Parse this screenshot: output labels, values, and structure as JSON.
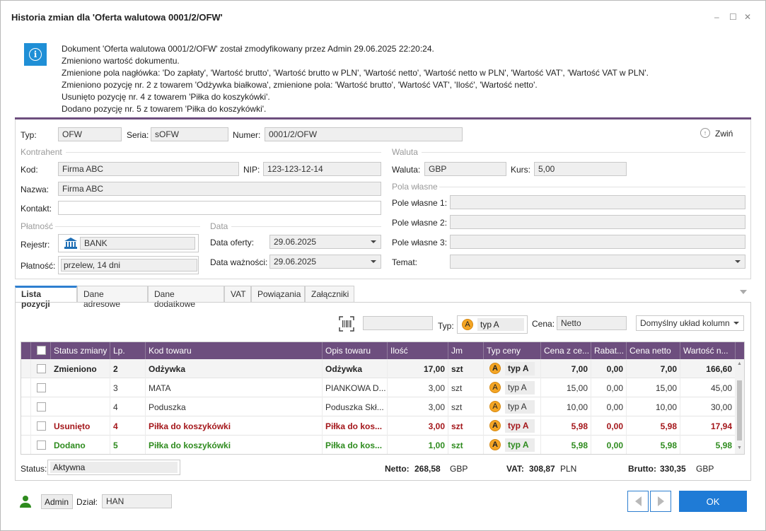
{
  "window": {
    "title": "Historia zmian dla 'Oferta walutowa 0001/2/OFW'",
    "min": "–",
    "max": "☐",
    "close": "✕"
  },
  "message": [
    "Dokument 'Oferta walutowa 0001/2/OFW' został zmodyfikowany przez Admin 29.06.2025 22:20:24.",
    "Zmieniono wartość dokumentu.",
    "Zmienione pola nagłówka: 'Do zapłaty', 'Wartość brutto', 'Wartość brutto w PLN', 'Wartość netto', 'Wartość netto w PLN', 'Wartość VAT', 'Wartość VAT w PLN'.",
    "Zmieniono pozycję nr. 2 z towarem 'Odżywka białkowa', zmienione pola: 'Wartość brutto', 'Wartość VAT', 'Ilość', 'Wartość netto'.",
    "Usunięto pozycję nr. 4 z towarem 'Piłka do koszykówki'.",
    "Dodano pozycję nr. 5 z towarem 'Piłka do koszykówki'."
  ],
  "header": {
    "typ_label": "Typ:",
    "typ": "OFW",
    "seria_label": "Seria:",
    "seria": "sOFW",
    "numer_label": "Numer:",
    "numer": "0001/2/OFW",
    "collapse": "Zwiń"
  },
  "kontrahent": {
    "section": "Kontrahent",
    "kod_label": "Kod:",
    "kod": "Firma ABC",
    "nip_label": "NIP:",
    "nip": "123-123-12-14",
    "nazwa_label": "Nazwa:",
    "nazwa": "Firma ABC",
    "kontakt_label": "Kontakt:",
    "kontakt": ""
  },
  "platnosc": {
    "section": "Płatność",
    "rejestr_label": "Rejestr:",
    "rejestr": "BANK",
    "platnosc_label": "Płatność:",
    "platnosc": "przelew, 14 dni"
  },
  "data": {
    "section": "Data",
    "oferty_label": "Data oferty:",
    "oferty": "29.06.2025",
    "waznosci_label": "Data ważności:",
    "waznosci": "29.06.2025"
  },
  "waluta": {
    "section": "Waluta",
    "waluta_label": "Waluta:",
    "waluta": "GBP",
    "kurs_label": "Kurs:",
    "kurs": "5,00"
  },
  "pola": {
    "section": "Pola własne",
    "p1": "Pole własne 1:",
    "p2": "Pole własne 2:",
    "p3": "Pole własne 3:",
    "temat": "Temat:"
  },
  "tabs": [
    "Lista pozycji",
    "Dane adresowe",
    "Dane dodatkowe",
    "VAT",
    "Powiązania",
    "Załączniki"
  ],
  "toolbar": {
    "typ_label": "Typ:",
    "typ": "typ A",
    "typ_badge": "A",
    "cena_label": "Cena:",
    "cena": "Netto",
    "layout": "Domyślny układ kolumn"
  },
  "grid": {
    "headers": [
      "Status zmiany",
      "Lp.",
      "Kod towaru",
      "Opis towaru",
      "Ilość",
      "Jm",
      "Typ ceny",
      "Cena z ce...",
      "Rabat...",
      "Cena netto",
      "Wartość n..."
    ],
    "rows": [
      {
        "status": "Zmieniono",
        "lp": "2",
        "kod": "Odżywka",
        "opis": "Odżywka",
        "ilosc": "17,00",
        "jm": "szt",
        "badge": "A",
        "typ": "typ A",
        "cena_z": "7,00",
        "rabat": "0,00",
        "netto": "7,00",
        "wartosc": "166,60",
        "style": "bold",
        "color": "#222222"
      },
      {
        "status": "",
        "lp": "3",
        "kod": "MATA",
        "opis": "PIANKOWA D...",
        "ilosc": "3,00",
        "jm": "szt",
        "badge": "A",
        "typ": "typ A",
        "cena_z": "15,00",
        "rabat": "0,00",
        "netto": "15,00",
        "wartosc": "45,00",
        "style": "normal",
        "color": "#333333"
      },
      {
        "status": "",
        "lp": "4",
        "kod": "Poduszka",
        "opis": "Poduszka  Skł...",
        "ilosc": "3,00",
        "jm": "szt",
        "badge": "A",
        "typ": "typ A",
        "cena_z": "10,00",
        "rabat": "0,00",
        "netto": "10,00",
        "wartosc": "30,00",
        "style": "normal",
        "color": "#333333"
      },
      {
        "status": "Usunięto",
        "lp": "4",
        "kod": "Piłka do koszykówki",
        "opis": "Piłka do kos...",
        "ilosc": "3,00",
        "jm": "szt",
        "badge": "A",
        "typ": "typ A",
        "cena_z": "5,98",
        "rabat": "0,00",
        "netto": "5,98",
        "wartosc": "17,94",
        "style": "bold",
        "color": "#a4161a"
      },
      {
        "status": "Dodano",
        "lp": "5",
        "kod": "Piłka do koszykówki",
        "opis": "Piłka do kos...",
        "ilosc": "1,00",
        "jm": "szt",
        "badge": "A",
        "typ": "typ A",
        "cena_z": "5,98",
        "rabat": "0,00",
        "netto": "5,98",
        "wartosc": "5,98",
        "style": "bold",
        "color": "#2e8b1e"
      }
    ]
  },
  "summary": {
    "status_label": "Status:",
    "status": "Aktywna",
    "netto_label": "Netto:",
    "netto": "268,58",
    "netto_cur": "GBP",
    "vat_label": "VAT:",
    "vat": "308,87",
    "vat_cur": "PLN",
    "brutto_label": "Brutto:",
    "brutto": "330,35",
    "brutto_cur": "GBP"
  },
  "footer": {
    "user": "Admin",
    "dzial_label": "Dział:",
    "dzial": "HAN",
    "ok": "OK"
  }
}
